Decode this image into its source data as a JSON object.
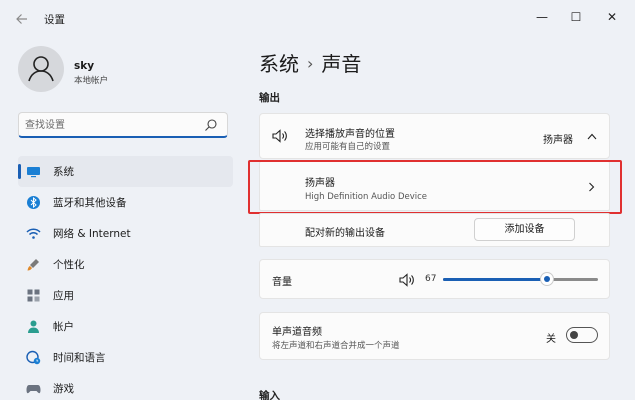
{
  "window": {
    "title": "设置",
    "controls": {
      "minimize": "—",
      "maximize": "☐",
      "close": "✕"
    }
  },
  "profile": {
    "name": "sky",
    "subtitle": "本地帐户"
  },
  "search": {
    "placeholder": "查找设置"
  },
  "sidebar": {
    "items": [
      {
        "label": "系统",
        "icon": "monitor-icon",
        "active": true
      },
      {
        "label": "蓝牙和其他设备",
        "icon": "bluetooth-icon"
      },
      {
        "label": "网络 & Internet",
        "icon": "wifi-icon"
      },
      {
        "label": "个性化",
        "icon": "brush-icon"
      },
      {
        "label": "应用",
        "icon": "apps-icon"
      },
      {
        "label": "帐户",
        "icon": "person-icon"
      },
      {
        "label": "时间和语言",
        "icon": "globe-clock-icon"
      },
      {
        "label": "游戏",
        "icon": "gamepad-icon"
      }
    ]
  },
  "header": {
    "breadcrumb_parent": "系统",
    "breadcrumb_separator": "›",
    "page_title": "声音"
  },
  "output": {
    "section_label": "输出",
    "choose_device": {
      "title": "选择播放声音的位置",
      "subtitle": "应用可能有自己的设置",
      "value": "扬声器"
    },
    "speaker_device": {
      "title": "扬声器",
      "subtitle": "High Definition Audio Device"
    },
    "pair_new": {
      "label": "配对新的输出设备",
      "button": "添加设备"
    },
    "volume": {
      "label": "音量",
      "value_text": "67",
      "value": 67
    },
    "mono_audio": {
      "title": "单声道音频",
      "subtitle": "将左声道和右声道合并成一个声道",
      "state_label": "关"
    }
  },
  "input": {
    "section_label": "输入"
  },
  "colors": {
    "accent": "#1a5fb4",
    "highlight": "#e03030"
  }
}
